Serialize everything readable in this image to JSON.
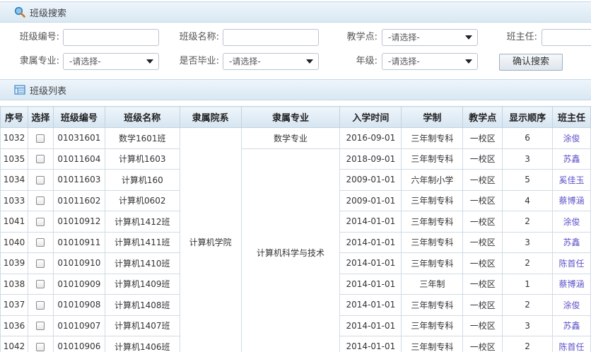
{
  "search_panel": {
    "title": "班级搜索"
  },
  "form": {
    "class_no_label": "班级编号:",
    "class_name_label": "班级名称:",
    "campus_label": "教学点:",
    "campus_value": "-请选择-",
    "head_teacher_label": "班主任:",
    "major_label": "隶属专业:",
    "major_value": "-请选择-",
    "graduated_label": "是否毕业:",
    "graduated_value": "-请选择-",
    "grade_label": "年级:",
    "grade_value": "-请选择-",
    "search_button": "确认搜索"
  },
  "list_panel": {
    "title": "班级列表"
  },
  "table": {
    "headers": [
      "序号",
      "选择",
      "班级编号",
      "班级名称",
      "隶属院系",
      "隶属专业",
      "入学时间",
      "学制",
      "教学点",
      "显示顺序",
      "班主任"
    ],
    "department": "计算机学院",
    "majors": [
      "数学专业",
      "计算机科学与技术"
    ],
    "rows": [
      {
        "id": "1032",
        "code": "01031601",
        "name": "数学1601班",
        "date": "2016-09-01",
        "system": "三年制专科",
        "campus": "一校区",
        "order": "6",
        "teacher": "涂俊"
      },
      {
        "id": "1035",
        "code": "01011604",
        "name": "计算机1603",
        "date": "2018-09-01",
        "system": "三年制专科",
        "campus": "一校区",
        "order": "3",
        "teacher": "苏鑫"
      },
      {
        "id": "1034",
        "code": "01011603",
        "name": "计算机160",
        "date": "2009-01-01",
        "system": "六年制小学",
        "campus": "一校区",
        "order": "5",
        "teacher": "奚佳玉"
      },
      {
        "id": "1033",
        "code": "01011602",
        "name": "计算机0602",
        "date": "2009-01-01",
        "system": "三年制专科",
        "campus": "一校区",
        "order": "4",
        "teacher": "蔡博涵"
      },
      {
        "id": "1041",
        "code": "01010912",
        "name": "计算机1412班",
        "date": "2014-01-01",
        "system": "三年制专科",
        "campus": "一校区",
        "order": "2",
        "teacher": "涂俊"
      },
      {
        "id": "1040",
        "code": "01010911",
        "name": "计算机1411班",
        "date": "2014-01-01",
        "system": "三年制专科",
        "campus": "一校区",
        "order": "3",
        "teacher": "苏鑫"
      },
      {
        "id": "1039",
        "code": "01010910",
        "name": "计算机1410班",
        "date": "2014-01-01",
        "system": "三年制专科",
        "campus": "一校区",
        "order": "2",
        "teacher": "陈首任"
      },
      {
        "id": "1038",
        "code": "01010909",
        "name": "计算机1409班",
        "date": "2014-01-01",
        "system": "三年制",
        "campus": "一校区",
        "order": "1",
        "teacher": "蔡博涵"
      },
      {
        "id": "1037",
        "code": "01010908",
        "name": "计算机1408班",
        "date": "2014-01-01",
        "system": "三年制专科",
        "campus": "一校区",
        "order": "2",
        "teacher": "涂俊"
      },
      {
        "id": "1036",
        "code": "01010907",
        "name": "计算机1407班",
        "date": "2014-01-01",
        "system": "三年制专科",
        "campus": "一校区",
        "order": "3",
        "teacher": "苏鑫"
      },
      {
        "id": "1042",
        "code": "01010906",
        "name": "计算机1406班",
        "date": "2014-01-01",
        "system": "三年制专科",
        "campus": "一校区",
        "order": "2",
        "teacher": "陈首任"
      }
    ]
  }
}
